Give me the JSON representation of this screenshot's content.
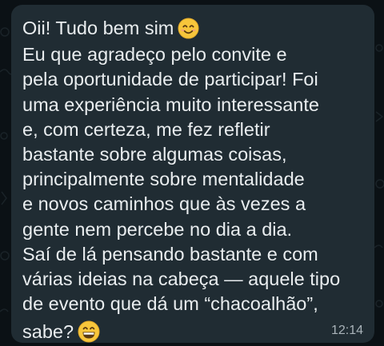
{
  "message": {
    "greeting": "Oii! Tudo bem sim",
    "greeting_emoji": "smiling-face-icon",
    "lines": [
      "Eu que agradeço pelo convite e",
      "pela oportunidade de participar! Foi",
      "uma experiência muito interessante",
      "e, com certeza, me fez refletir",
      "bastante sobre algumas coisas,",
      "principalmente sobre mentalidade",
      "e novos caminhos que às vezes a",
      "gente nem percebe no dia a dia.",
      "Saí de lá pensando bastante e com",
      "várias ideias na cabeça — aquele tipo",
      "de evento que dá um “chacoalhão”,"
    ],
    "closing": "sabe?",
    "closing_emoji": "grinning-face-icon",
    "time": "12:14"
  },
  "colors": {
    "background": "#0b1115",
    "bubble": "#202c33",
    "text": "#e9edef",
    "timestamp": "#a9b3b9",
    "emoji": "#f7c63b"
  }
}
